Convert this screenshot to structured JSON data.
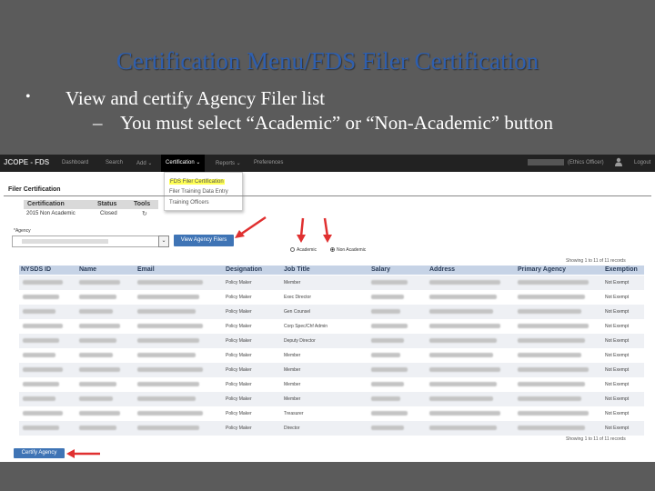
{
  "slide": {
    "title": "Certification Menu/FDS Filer Certification",
    "bullet1_marker": "•",
    "bullet1": "View and certify Agency Filer list",
    "bullet2_marker": "–",
    "bullet2": "You must select “Academic” or “Non-Academic” button"
  },
  "navbar": {
    "brand": "JCOPE - FDS",
    "items": [
      "Dashboard",
      "Search",
      "Add ⌄",
      "Certification ⌄",
      "Reports ⌄",
      "Preferences"
    ],
    "user_suffix": "(Ethics Officer)",
    "user_icon": "person-icon",
    "logout": "Logout"
  },
  "dropdown": {
    "items": [
      "FDS Filer Certification",
      "Filer Training Data Entry",
      "Training Officers"
    ]
  },
  "filer_cert": {
    "heading": "Filer Certification",
    "columns": [
      "Certification",
      "Status",
      "Tools"
    ],
    "row": {
      "certification": "2015 Non Academic",
      "status": "Closed",
      "tools_icon": "refresh-icon",
      "tools_glyph": "↻"
    },
    "agency_label": "*Agency",
    "agency_arrow": "⌄",
    "view_button": "View Agency Filers",
    "radio_academic": "Academic",
    "radio_non_academic": "Non Academic",
    "selected_radio": "Non Academic",
    "showing_text": "Showing 1 to 11 of 11 records",
    "certify_button": "Certify Agency"
  },
  "table": {
    "headers": [
      "NYSDS ID",
      "Name",
      "Email",
      "Designation",
      "Job Title",
      "Salary",
      "Address",
      "Primary Agency",
      "Exemption"
    ],
    "rows": [
      {
        "designation": "Policy Maker",
        "job_title": "Member",
        "exemption": "Not Exempt"
      },
      {
        "designation": "Policy Maker",
        "job_title": "Exec Director",
        "exemption": "Not Exempt"
      },
      {
        "designation": "Policy Maker",
        "job_title": "Gen Counsel",
        "exemption": "Not Exempt"
      },
      {
        "designation": "Policy Maker",
        "job_title": "Corp Spec/Chf Admin",
        "exemption": "Not Exempt"
      },
      {
        "designation": "Policy Maker",
        "job_title": "Deputy Director",
        "exemption": "Not Exempt"
      },
      {
        "designation": "Policy Maker",
        "job_title": "Member",
        "exemption": "Not Exempt"
      },
      {
        "designation": "Policy Maker",
        "job_title": "Member",
        "exemption": "Not Exempt"
      },
      {
        "designation": "Policy Maker",
        "job_title": "Member",
        "exemption": "Not Exempt"
      },
      {
        "designation": "Policy Maker",
        "job_title": "Member",
        "exemption": "Not Exempt"
      },
      {
        "designation": "Policy Maker",
        "job_title": "Treasurer",
        "exemption": "Not Exempt"
      },
      {
        "designation": "Policy Maker",
        "job_title": "Director",
        "exemption": "Not Exempt"
      }
    ]
  },
  "colors": {
    "slide_bg": "#5b5b5b",
    "title": "#2f5fae",
    "navbar": "#222222",
    "button": "#3f74b5",
    "annotation_arrow": "#e03030",
    "highlight": "#ffff55"
  }
}
